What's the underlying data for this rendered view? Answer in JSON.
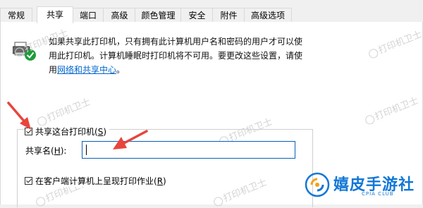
{
  "tabs": [
    {
      "label": "常规",
      "active": false
    },
    {
      "label": "共享",
      "active": true
    },
    {
      "label": "端口",
      "active": false
    },
    {
      "label": "高级",
      "active": false
    },
    {
      "label": "颜色管理",
      "active": false
    },
    {
      "label": "安全",
      "active": false
    },
    {
      "label": "附件",
      "active": false
    },
    {
      "label": "高级选项",
      "active": false
    }
  ],
  "info": {
    "line1": "如果共享此打印机，只有拥有此计算机用户名和密码的用户才可以使",
    "line2": "用此打印机。计算机睡眠时打印机将不可用。要更改这些设置，请使",
    "line3_prefix": "用",
    "link": "网络和共享中心",
    "line3_suffix": "。"
  },
  "share_checkbox": {
    "label": "共享这台打印机",
    "accel_open": "(",
    "accel": "S",
    "accel_close": ")",
    "checked": true
  },
  "share_name": {
    "label": "共享名",
    "accel_open": "(",
    "accel": "H",
    "accel_close": "):",
    "value": ""
  },
  "render_checkbox": {
    "label": "在客户端计算机上呈现打印作业",
    "accel_open": "(",
    "accel": "R",
    "accel_close": ")",
    "checked": true
  },
  "watermarks": [
    "打印机卫士",
    "打印机卫士",
    "打印机卫士",
    "打印机卫士",
    "打印机卫士",
    "打印机卫士",
    "打印机卫士"
  ],
  "logo": {
    "main": "嬉皮手游社",
    "sub": "CPIA CLUB"
  },
  "colors": {
    "link": "#0066cc",
    "arrow": "#e8453c",
    "logo": "#1277d6",
    "input_border": "#0a5fb4"
  },
  "icons": [
    "printer-share-icon",
    "checkmark-icon",
    "red-arrow-icon",
    "logo-circle-icon"
  ]
}
